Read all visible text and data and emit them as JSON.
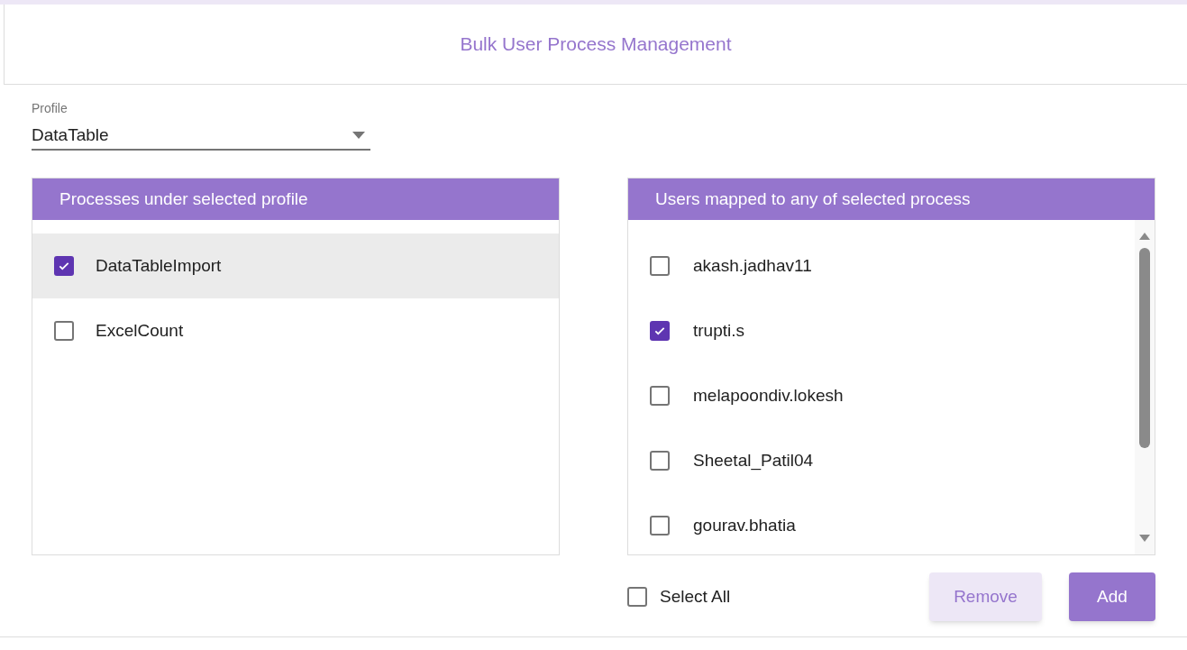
{
  "title": "Bulk User Process Management",
  "profile": {
    "label": "Profile",
    "value": "DataTable"
  },
  "processes": {
    "header": "Processes under selected profile",
    "items": [
      {
        "label": "DataTableImport",
        "checked": true,
        "selected": true
      },
      {
        "label": "ExcelCount",
        "checked": false,
        "selected": false
      }
    ]
  },
  "users": {
    "header": "Users mapped to any of selected process",
    "items": [
      {
        "label": "akash.jadhav11",
        "checked": false
      },
      {
        "label": "trupti.s",
        "checked": true
      },
      {
        "label": "melapoondiv.lokesh",
        "checked": false
      },
      {
        "label": "Sheetal_Patil04",
        "checked": false
      },
      {
        "label": "gourav.bhatia",
        "checked": false
      }
    ]
  },
  "select_all": {
    "label": "Select All",
    "checked": false
  },
  "buttons": [
    {
      "label": "Remove",
      "kind": "secondary"
    },
    {
      "label": "Add",
      "kind": "primary"
    }
  ]
}
